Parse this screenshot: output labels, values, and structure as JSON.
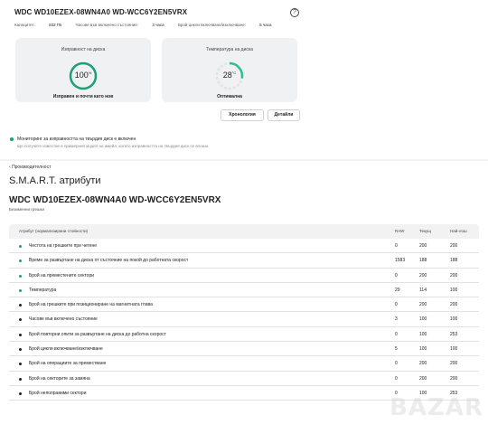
{
  "disk": {
    "title": "WDC WD10EZEX-08WN4A0 WD-WCC6Y2EN5VRX",
    "info": [
      {
        "label": "Капацитет:",
        "value": "932 ГБ"
      },
      {
        "label": "Часове във включено състояние:",
        "value": "3 часа"
      },
      {
        "label": "Брой цикли включване/изключване:",
        "value": "5 часа"
      }
    ]
  },
  "health": {
    "title": "Изправност на диска",
    "value": "100",
    "unit": "%",
    "status": "Изправен и почти като нов",
    "level": 1.0
  },
  "temperature": {
    "title": "Температура на диска",
    "value": "28",
    "unit": "°C",
    "status": "Оптимална",
    "level": 0.28
  },
  "buttons": {
    "history": "Хронология",
    "details": "Детайли"
  },
  "monitor": {
    "label": "Мониторинг за изправността на твърдия диск е включен",
    "note": "Ще получите известие в примерния модел на имейл, когато изправността на твърдия диск се влоши."
  },
  "performance": {
    "back": "Производителност",
    "smart_title": "S.M.A.R.T. атрибути",
    "model": "WDC WD10EZEX-08WN4A0 WD-WCC6Y2EN5VRX",
    "errors": "Безименни грешки"
  },
  "table": {
    "headers": {
      "name": "Атрибут (нормализирани стойности)",
      "raw": "RAW",
      "current": "Текущ",
      "worst": "Най-лош"
    },
    "rows": [
      {
        "name": "Честота на грешките при четене",
        "raw": "0",
        "current": "200",
        "worst": "200",
        "status_color": "#1aa07a"
      },
      {
        "name": "Време за развъртане на диска от състояние на покой до работната скорост",
        "raw": "1583",
        "current": "188",
        "worst": "188",
        "status_color": "#1aa07a"
      },
      {
        "name": "Брой на преместените сектори",
        "raw": "0",
        "current": "200",
        "worst": "200",
        "status_color": "#1aa07a"
      },
      {
        "name": "Температура",
        "raw": "29",
        "current": "114",
        "worst": "100",
        "status_color": "#1aa07a"
      },
      {
        "name": "Брой на грешките при позициониране на магнитната глава",
        "raw": "0",
        "current": "200",
        "worst": "200",
        "status_color": "#222222"
      },
      {
        "name": "Часове във включено състояние",
        "raw": "3",
        "current": "100",
        "worst": "100",
        "status_color": "#222222"
      },
      {
        "name": "Брой повторни опити за развъртане на диска до работна скорост",
        "raw": "0",
        "current": "100",
        "worst": "253",
        "status_color": "#222222"
      },
      {
        "name": "Брой цикли включване/изключване",
        "raw": "5",
        "current": "100",
        "worst": "100",
        "status_color": "#222222"
      },
      {
        "name": "Брой на операциите за преместване",
        "raw": "0",
        "current": "200",
        "worst": "200",
        "status_color": "#222222"
      },
      {
        "name": "Брой на секторите за замяна",
        "raw": "0",
        "current": "200",
        "worst": "200",
        "status_color": "#222222"
      },
      {
        "name": "Брой непоправими сектори",
        "raw": "0",
        "current": "100",
        "worst": "253",
        "status_color": "#222222"
      }
    ]
  },
  "watermark": "BAZAR",
  "colors": {
    "accent": "#1aa07a",
    "temp_gauge": "#2fbf8f"
  }
}
